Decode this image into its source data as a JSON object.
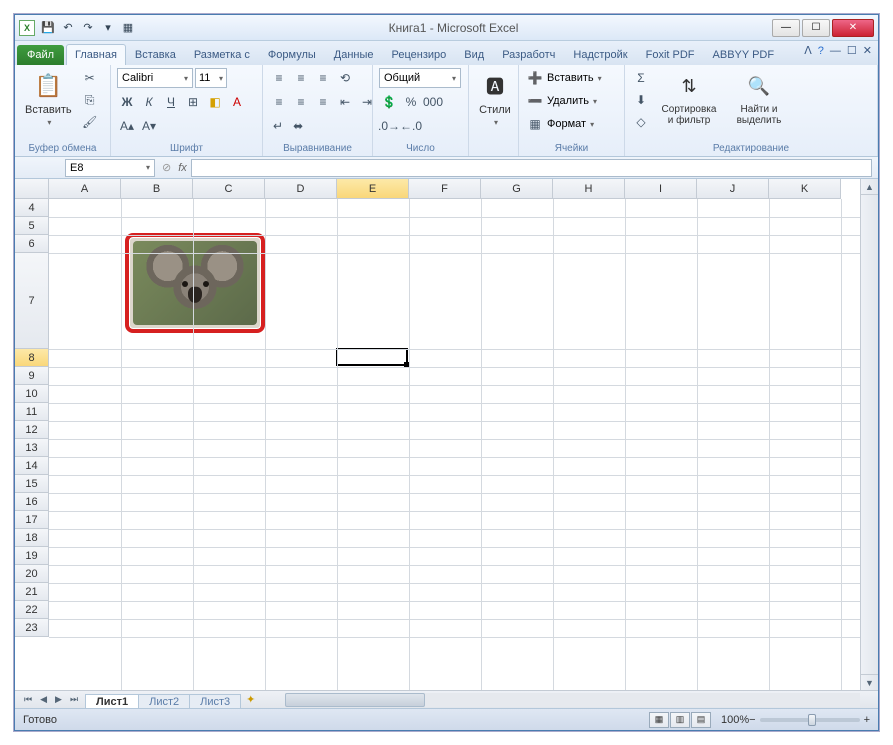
{
  "window": {
    "title": "Книга1 - Microsoft Excel"
  },
  "qat": {
    "save": "💾",
    "undo": "↶",
    "redo": "↷",
    "new": "▦"
  },
  "tabs": {
    "file": "Файл",
    "items": [
      "Главная",
      "Вставка",
      "Разметка с",
      "Формулы",
      "Данные",
      "Рецензиро",
      "Вид",
      "Разработч",
      "Надстройк",
      "Foxit PDF",
      "ABBYY PDF"
    ],
    "active": 0
  },
  "ribbon": {
    "clipboard": {
      "title": "Буфер обмена",
      "paste": "Вставить"
    },
    "font": {
      "title": "Шрифт",
      "name": "Calibri",
      "size": "11"
    },
    "align": {
      "title": "Выравнивание"
    },
    "number": {
      "title": "Число",
      "format": "Общий"
    },
    "styles": {
      "title": "",
      "label": "Стили"
    },
    "cells": {
      "title": "Ячейки",
      "insert": "Вставить",
      "delete": "Удалить",
      "format": "Формат"
    },
    "editing": {
      "title": "Редактирование",
      "sort": "Сортировка и фильтр",
      "find": "Найти и выделить"
    }
  },
  "formula_bar": {
    "name_box": "E8",
    "fx": "fx"
  },
  "grid": {
    "columns": [
      "A",
      "B",
      "C",
      "D",
      "E",
      "F",
      "G",
      "H",
      "I",
      "J",
      "K"
    ],
    "rows": [
      4,
      5,
      6,
      7,
      8,
      9,
      10,
      11,
      12,
      13,
      14,
      15,
      16,
      17,
      18,
      19,
      20,
      21,
      22,
      23
    ],
    "tall_row": 7,
    "selected_cell": "E8",
    "selected_col": "E",
    "selected_row": 8
  },
  "sheets": {
    "tabs": [
      "Лист1",
      "Лист2",
      "Лист3"
    ],
    "active": 0
  },
  "statusbar": {
    "ready": "Готово",
    "zoom": "100%"
  },
  "image": {
    "alt": "koala-picture"
  }
}
